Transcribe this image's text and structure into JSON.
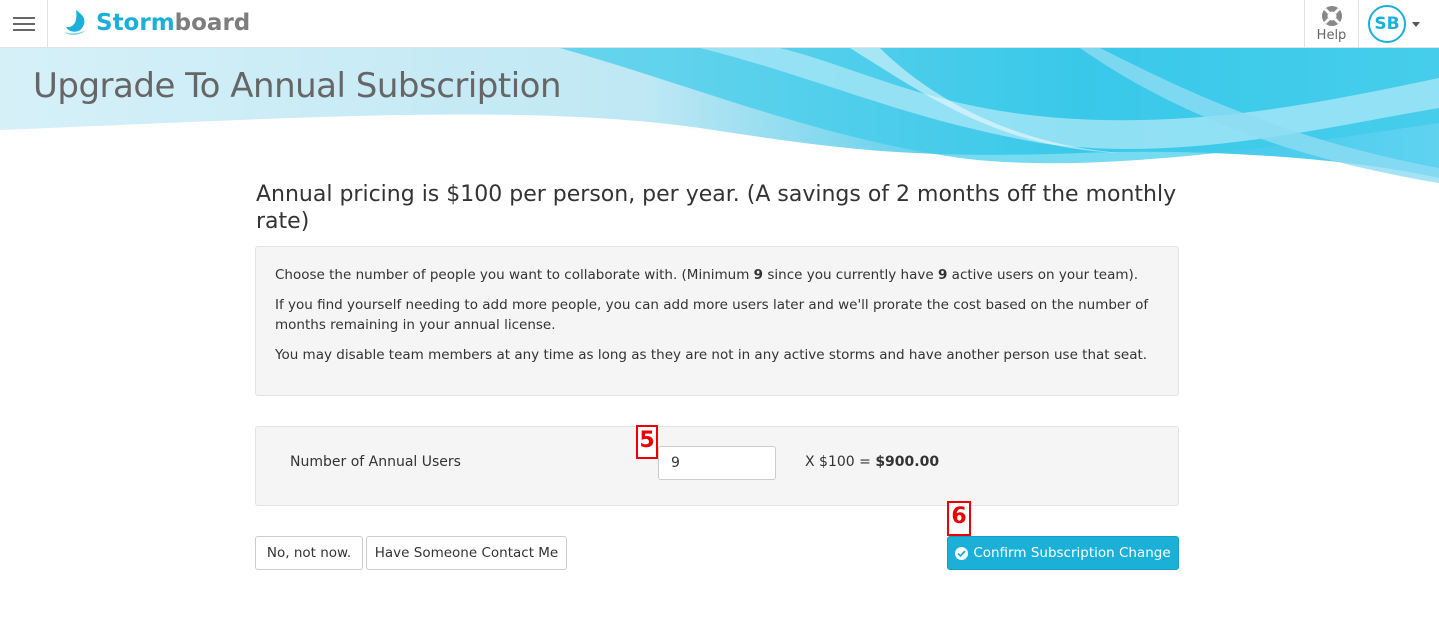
{
  "app": {
    "logo_text_accent": "Storm",
    "logo_text_rest": "board",
    "help_label": "Help",
    "avatar_initials": "SB",
    "brand_color": "#1ab0d8"
  },
  "icons": {
    "menu": "hamburger-menu-icon",
    "help": "lifebuoy-icon",
    "confirm": "check-circle-icon"
  },
  "page": {
    "title": "Upgrade To Annual Subscription",
    "headline": "Annual pricing is $100 per person, per year. (A savings of 2 months off the monthly rate)",
    "info": {
      "line1_pre": "Choose the number of people you want to collaborate with. (Minimum ",
      "line1_min": "9",
      "line1_mid": " since you currently have ",
      "line1_active": "9",
      "line1_post": " active users on your team).",
      "line2": "If you find yourself needing to add more people, you can add more users later and we'll prorate the cost based on the number of months remaining in your annual license.",
      "line3": "You may disable team members at any time as long as they are not in any active storms and have another person use that seat."
    },
    "users": {
      "label": "Number of Annual Users",
      "value": "9",
      "price_prefix": "X $100 = ",
      "total": "$900.00"
    },
    "buttons": {
      "no": "No, not now.",
      "contact": "Have Someone Contact Me",
      "confirm": "Confirm Subscription Change"
    },
    "markers": {
      "step5": "5",
      "step6": "6"
    }
  }
}
